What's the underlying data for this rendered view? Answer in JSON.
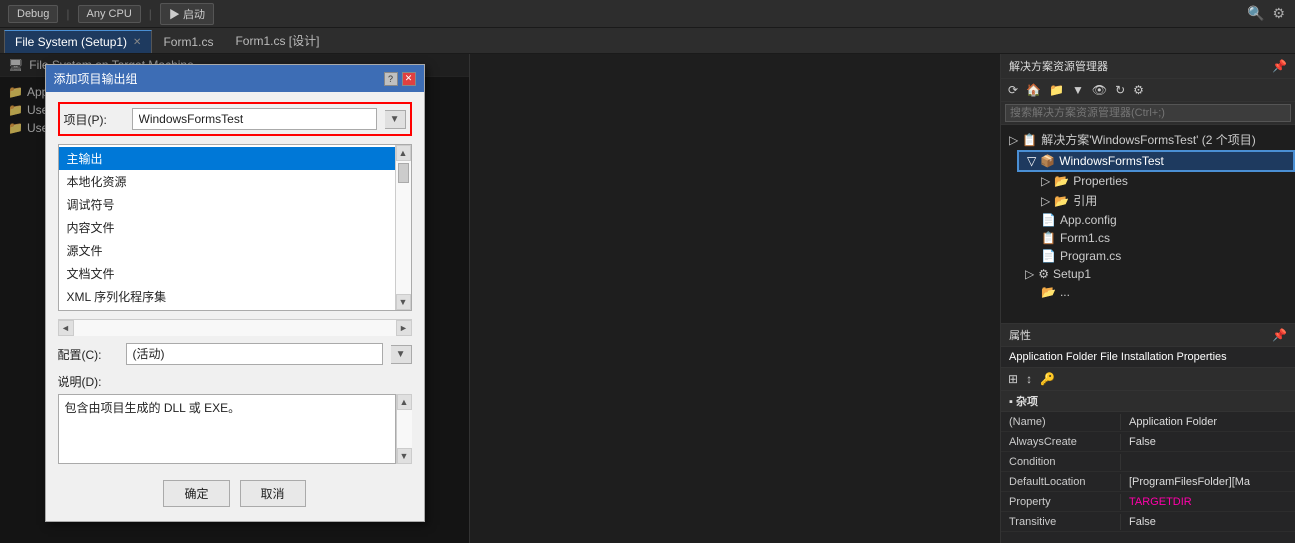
{
  "toolbar": {
    "debug_label": "Debug",
    "cpu_label": "Any CPU",
    "start_label": "▶ 启动",
    "items": [
      "Debug",
      "Any CPU",
      "▶ 启动"
    ]
  },
  "tabs": [
    {
      "label": "File System (Setup1)",
      "active": true,
      "closeable": true
    },
    {
      "label": "Form1.cs",
      "active": false,
      "closeable": false
    },
    {
      "label": "Form1.cs [设计]",
      "active": false,
      "closeable": false
    }
  ],
  "left_panel": {
    "header": "File System on Target Machine",
    "tree": [
      {
        "label": "Application Folder",
        "icon": "📁",
        "level": 1
      },
      {
        "label": "User's Desktop",
        "icon": "📁",
        "level": 1
      },
      {
        "label": "User's Programs Menu",
        "icon": "📁",
        "level": 1
      }
    ]
  },
  "dialog": {
    "title": "添加项目输出组",
    "project_label": "项目(P):",
    "project_value": "WindowsFormsTest",
    "list_items": [
      {
        "label": "主输出",
        "selected": true
      },
      {
        "label": "本地化资源",
        "selected": false
      },
      {
        "label": "调试符号",
        "selected": false
      },
      {
        "label": "内容文件",
        "selected": false
      },
      {
        "label": "源文件",
        "selected": false
      },
      {
        "label": "文档文件",
        "selected": false
      },
      {
        "label": "XML 序列化程序集",
        "selected": false
      }
    ],
    "config_label": "配置(C):",
    "config_value": "(活动)",
    "desc_label": "说明(D):",
    "desc_text": "包含由项目生成的 DLL 或 EXE。",
    "ok_label": "确定",
    "cancel_label": "取消"
  },
  "right_panel": {
    "header": "解决方案资源管理器",
    "search_placeholder": "搜索解决方案资源管理器(Ctrl+;)",
    "solution_label": "解决方案'WindowsFormsTest' (2 个项目)",
    "items": [
      {
        "label": "WindowsFormsTest",
        "icon": "📦",
        "level": 0,
        "selected": true
      },
      {
        "label": "Properties",
        "icon": "📂",
        "level": 1
      },
      {
        "label": "引用",
        "icon": "📂",
        "level": 1
      },
      {
        "label": "App.config",
        "icon": "📄",
        "level": 1
      },
      {
        "label": "Form1.cs",
        "icon": "📋",
        "level": 1
      },
      {
        "label": "Program.cs",
        "icon": "📄",
        "level": 1
      },
      {
        "label": "Setup1",
        "icon": "⚙",
        "level": 0
      },
      {
        "label": "...",
        "icon": "📂",
        "level": 1
      }
    ]
  },
  "properties": {
    "header": "属性",
    "title": "Application Folder  File Installation Properties",
    "section": "杂项",
    "rows": [
      {
        "key": "(Name)",
        "value": "Application Folder"
      },
      {
        "key": "AlwaysCreate",
        "value": "False"
      },
      {
        "key": "Condition",
        "value": ""
      },
      {
        "key": "DefaultLocation",
        "value": "[ProgramFilesFolder][Ma"
      },
      {
        "key": "Property",
        "value": "TARGETDIR"
      },
      {
        "key": "Transitive",
        "value": "False"
      }
    ]
  }
}
